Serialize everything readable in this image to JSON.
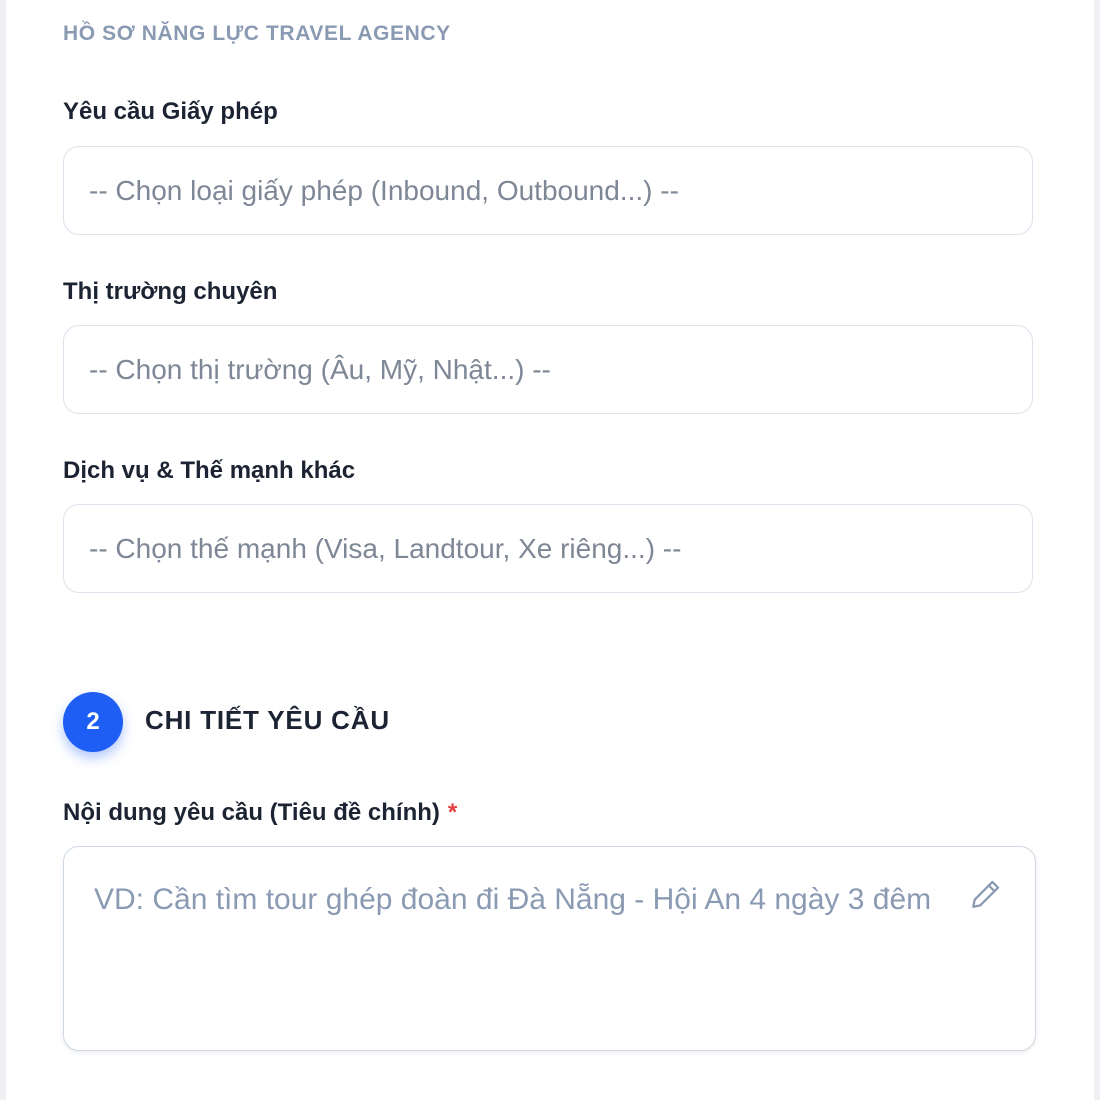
{
  "profile_section": {
    "title": "HỒ SƠ NĂNG LỰC TRAVEL AGENCY",
    "fields": [
      {
        "label": "Yêu cầu Giấy phép",
        "placeholder": "-- Chọn loại giấy phép (Inbound, Outbound...) --"
      },
      {
        "label": "Thị trường chuyên",
        "placeholder": "-- Chọn thị trường (Âu, Mỹ, Nhật...) --"
      },
      {
        "label": "Dịch vụ & Thế mạnh khác",
        "placeholder": "-- Chọn thế mạnh (Visa, Landtour, Xe riêng...) --"
      }
    ]
  },
  "request_section": {
    "step_number": "2",
    "title": "CHI TIẾT YÊU CẦU",
    "content_field": {
      "label": "Nội dung yêu cầu (Tiêu đề chính)",
      "required_mark": "*",
      "placeholder": "VD: Cần tìm tour ghép đoàn đi Đà Nẵng - Hội An 4 ngày 3 đêm",
      "icon": "pencil-icon"
    }
  },
  "colors": {
    "accent": "#1f5ef5",
    "required": "#e53e3e",
    "section_heading": "#8a9ab3",
    "label_text": "#1c2433",
    "placeholder_text": "#7e8796",
    "border": "#dde3ec"
  }
}
